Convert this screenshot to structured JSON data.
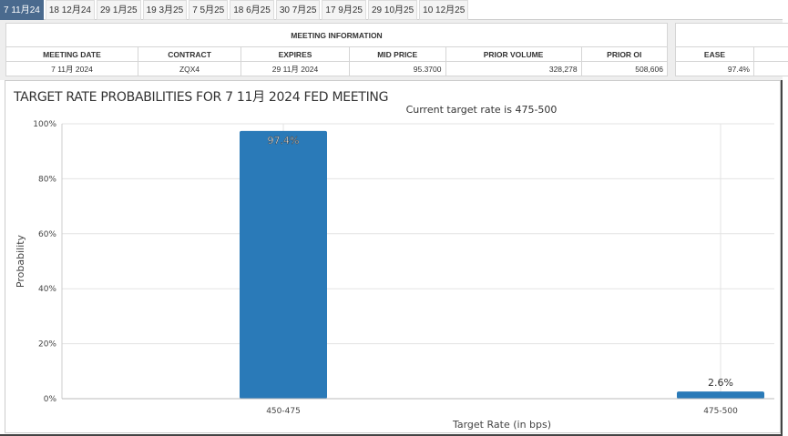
{
  "tabs": [
    "7 11月24",
    "18 12月24",
    "29 1月25",
    "19 3月25",
    "7 5月25",
    "18 6月25",
    "30 7月25",
    "17 9月25",
    "29 10月25",
    "10 12月25"
  ],
  "active_tab": 0,
  "meeting_info": {
    "title": "MEETING INFORMATION",
    "headers": [
      "MEETING DATE",
      "CONTRACT",
      "EXPIRES",
      "MID PRICE",
      "PRIOR VOLUME",
      "PRIOR OI"
    ],
    "row": [
      "7 11月 2024",
      "ZQX4",
      "29 11月 2024",
      "95.3700",
      "328,278",
      "508,606"
    ]
  },
  "probs": {
    "header": "EASE",
    "value": "97.4%"
  },
  "chart_title": "TARGET RATE PROBABILITIES FOR 7 11月 2024 FED MEETING",
  "chart_data": {
    "type": "bar",
    "title": "Current target rate is 475-500",
    "xlabel": "Target Rate (in bps)",
    "ylabel": "Probability",
    "categories": [
      "450-475",
      "475-500"
    ],
    "values": [
      97.4,
      2.6
    ],
    "labels": [
      "97.4%",
      "2.6%"
    ],
    "yticks": [
      "0%",
      "20%",
      "40%",
      "60%",
      "80%",
      "100%"
    ],
    "ylim": [
      0,
      100
    ],
    "color": "#2a7ab8"
  }
}
